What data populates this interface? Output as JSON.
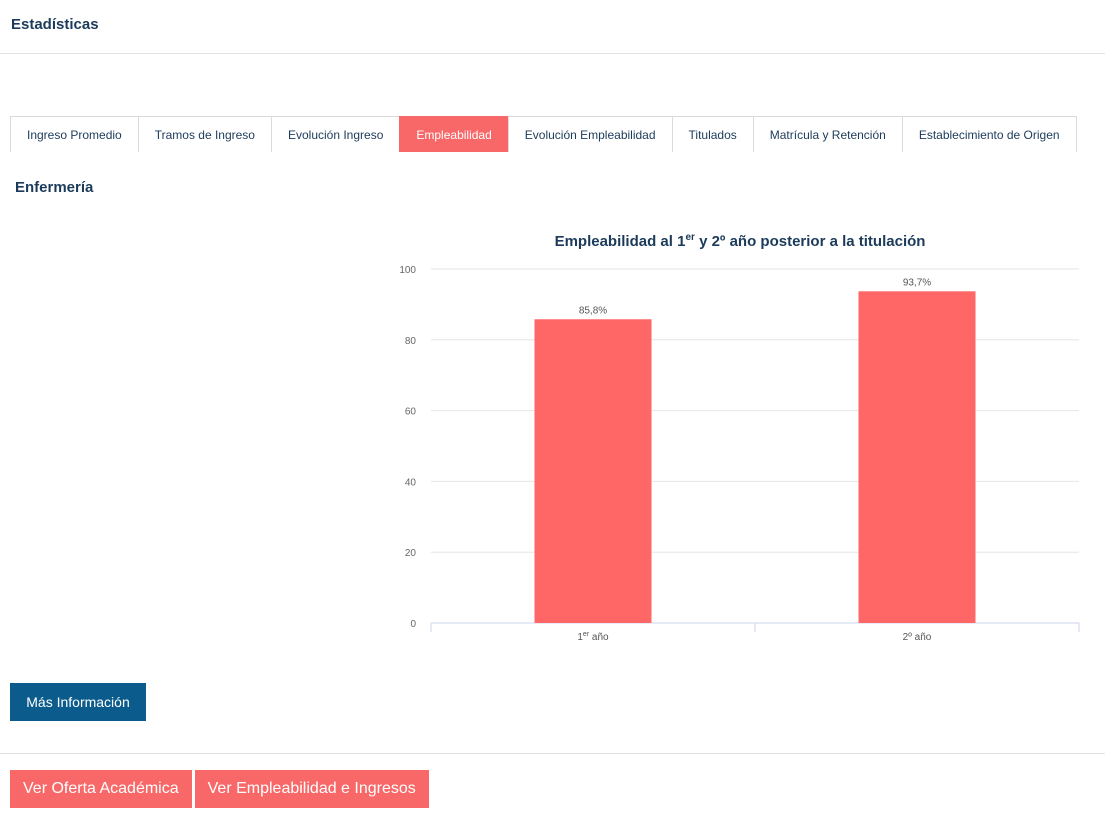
{
  "header": {
    "title": "Estadísticas"
  },
  "tabs": [
    {
      "label": "Ingreso Promedio",
      "active": false
    },
    {
      "label": "Tramos de Ingreso",
      "active": false
    },
    {
      "label": "Evolución Ingreso",
      "active": false
    },
    {
      "label": "Empleabilidad",
      "active": true
    },
    {
      "label": "Evolución Empleabilidad",
      "active": false
    },
    {
      "label": "Titulados",
      "active": false
    },
    {
      "label": "Matrícula y Retención",
      "active": false
    },
    {
      "label": "Establecimiento de Origen",
      "active": false
    }
  ],
  "section": {
    "title": "Enfermería"
  },
  "chart_data": {
    "type": "bar",
    "title_parts": {
      "before": "Empleabilidad al 1",
      "sup": "er",
      "after": " y 2º año posterior a la titulación"
    },
    "categories": [
      {
        "main": "1",
        "sup": "er",
        "rest": " año"
      },
      {
        "main": "2º año",
        "sup": "",
        "rest": ""
      }
    ],
    "values": [
      85.8,
      93.7
    ],
    "data_labels": [
      "85,8%",
      "93,7%"
    ],
    "ylim": [
      0,
      100
    ],
    "yticks": [
      0,
      20,
      40,
      60,
      80,
      100
    ],
    "grid": true,
    "bar_color": "#ff6666"
  },
  "buttons": {
    "more_info": "Más Información",
    "academic_offer": "Ver Oferta Académica",
    "employability_income": "Ver Empleabilidad e Ingresos"
  },
  "colors": {
    "accent": "#f96868",
    "primary": "#0b5c8c",
    "text": "#1c3b5a"
  }
}
